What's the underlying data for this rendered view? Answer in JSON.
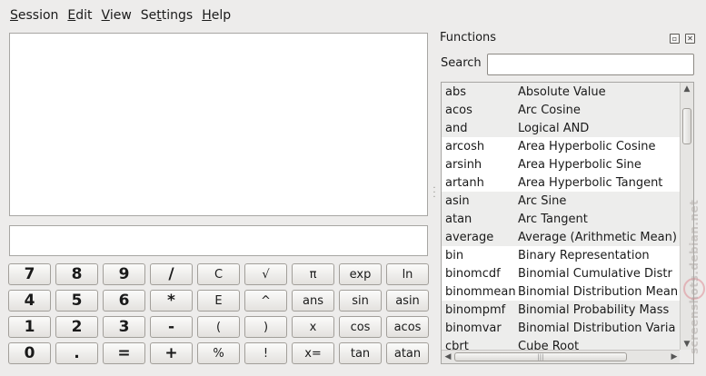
{
  "menu": {
    "items": [
      {
        "pre": "",
        "ul": "S",
        "post": "ession"
      },
      {
        "pre": "",
        "ul": "E",
        "post": "dit"
      },
      {
        "pre": "",
        "ul": "V",
        "post": "iew"
      },
      {
        "pre": "Se",
        "ul": "t",
        "post": "tings"
      },
      {
        "pre": "",
        "ul": "H",
        "post": "elp"
      }
    ]
  },
  "calculator": {
    "expression_value": "",
    "keys": [
      [
        "7",
        "8",
        "9",
        "/",
        "C",
        "√",
        "π",
        "exp",
        "ln"
      ],
      [
        "4",
        "5",
        "6",
        "*",
        "E",
        "^",
        "ans",
        "sin",
        "asin"
      ],
      [
        "1",
        "2",
        "3",
        "-",
        "(",
        ")",
        "x",
        "cos",
        "acos"
      ],
      [
        "0",
        ".",
        "=",
        "+",
        "%",
        "!",
        "x=",
        "tan",
        "atan"
      ]
    ]
  },
  "functions_dock": {
    "title": "Functions",
    "float_icon": "float-icon",
    "close_icon": "close-icon",
    "search_label": "Search",
    "search_value": "",
    "rows": [
      {
        "name": "abs",
        "description": "Absolute Value"
      },
      {
        "name": "acos",
        "description": "Arc Cosine"
      },
      {
        "name": "and",
        "description": "Logical AND"
      },
      {
        "name": "arcosh",
        "description": "Area Hyperbolic Cosine"
      },
      {
        "name": "arsinh",
        "description": "Area Hyperbolic Sine"
      },
      {
        "name": "artanh",
        "description": "Area Hyperbolic Tangent"
      },
      {
        "name": "asin",
        "description": "Arc Sine"
      },
      {
        "name": "atan",
        "description": "Arc Tangent"
      },
      {
        "name": "average",
        "description": "Average (Arithmetic Mean)"
      },
      {
        "name": "bin",
        "description": "Binary Representation"
      },
      {
        "name": "binomcdf",
        "description": "Binomial Cumulative Distr"
      },
      {
        "name": "binommean",
        "description": "Binomial Distribution Mean"
      },
      {
        "name": "binompmf",
        "description": "Binomial Probability Mass"
      },
      {
        "name": "binomvar",
        "description": "Binomial Distribution Varia"
      },
      {
        "name": "cbrt",
        "description": "Cube Root"
      }
    ],
    "alt_row_indices": [
      0,
      1,
      2,
      6,
      7,
      8,
      12,
      13,
      14
    ]
  },
  "watermark": "screenshots.debian.net",
  "colors": {
    "window_bg": "#edeceb",
    "field_bg": "#ffffff",
    "alt_row_bg": "#ededec",
    "key_border": "#a29f9a"
  }
}
